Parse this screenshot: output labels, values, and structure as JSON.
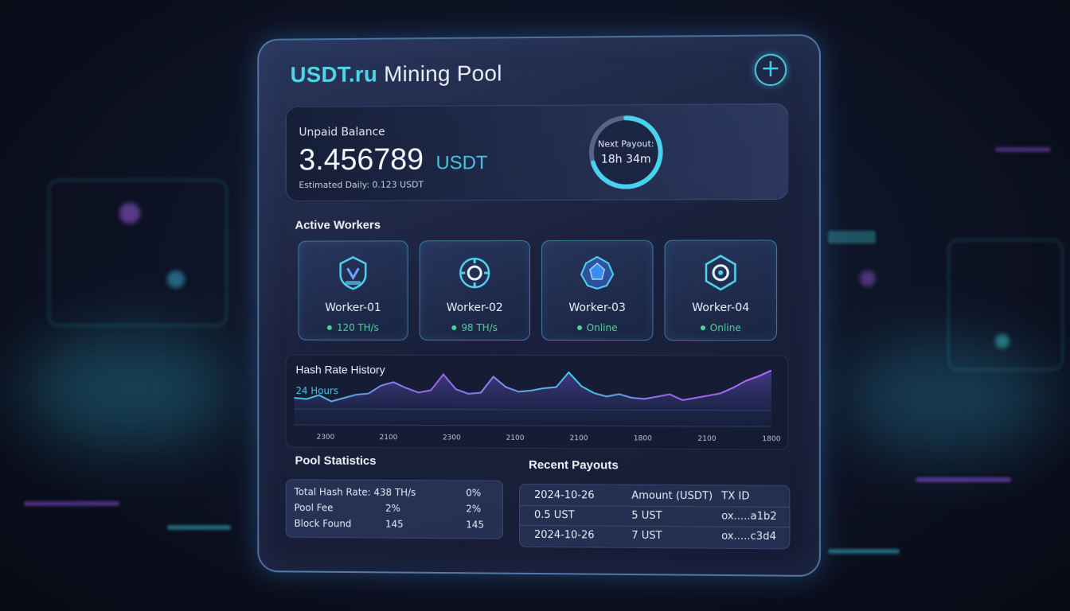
{
  "header": {
    "brand_primary": "USDT.ru",
    "brand_secondary": "Mining Pool",
    "add_icon": "plus-circle-icon"
  },
  "balance": {
    "label": "Unpaid Balance",
    "value": "3.456789",
    "unit": "USDT",
    "estimated": "Estimated Daily: 0.123 USDT",
    "next_payout_label": "Next Payout:",
    "next_payout_time": "18h 34m",
    "payout_progress": 0.7
  },
  "workers": {
    "title": "Active Workers",
    "items": [
      {
        "name": "Worker-01",
        "status": "120 TH/s",
        "icon": "shield-chip-icon"
      },
      {
        "name": "Worker-02",
        "status": "98 TH/s",
        "icon": "gear-ring-icon"
      },
      {
        "name": "Worker-03",
        "status": "Online",
        "icon": "crystal-gear-icon"
      },
      {
        "name": "Worker-04",
        "status": "Online",
        "icon": "hex-gear-icon"
      }
    ]
  },
  "hashrate": {
    "title": "Hash Rate History",
    "range": "24 Hours"
  },
  "chart_data": {
    "type": "line",
    "categories": [
      "2300",
      "2100",
      "2300",
      "2100",
      "2100",
      "1800",
      "2100",
      "1800"
    ],
    "series": [
      {
        "values": [
          50,
          48,
          55,
          44,
          50,
          56,
          58,
          72,
          78,
          68,
          60,
          64,
          92,
          66,
          58,
          60,
          88,
          70,
          62,
          64,
          68,
          70,
          96,
          72,
          60,
          54,
          58,
          52,
          50,
          54,
          58,
          48,
          52,
          56,
          60,
          70,
          82,
          90,
          100
        ]
      }
    ],
    "colors": [
      "#3fd0e0",
      "#a060f0"
    ]
  },
  "pool_stats": {
    "title": "Pool Statistics",
    "rows": [
      {
        "label": "Total Hash Rate: 438 TH/s",
        "value": "",
        "extra": "0%"
      },
      {
        "label": "Pool Fee",
        "value": "2%",
        "extra": "2%"
      },
      {
        "label": "Block Found",
        "value": "145",
        "extra": "145"
      }
    ]
  },
  "payouts": {
    "title": "Recent Payouts",
    "headers": [
      "2024-10-26",
      "Amount (USDT)",
      "TX ID"
    ],
    "rows": [
      [
        "0.5 UST",
        "5 UST",
        "ox.....a1b2"
      ],
      [
        "2024-10-26",
        "7 UST",
        "ox.....c3d4"
      ]
    ]
  }
}
